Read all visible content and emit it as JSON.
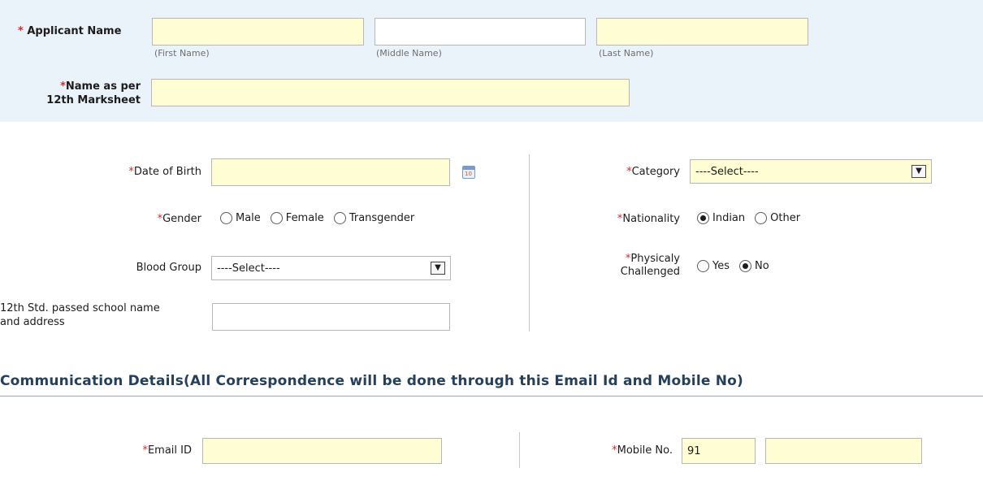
{
  "applicant": {
    "label": "Applicant Name",
    "first_hint": "(First Name)",
    "middle_hint": "(Middle Name)",
    "last_hint": "(Last Name)",
    "marksheet_label_line1": "Name as per",
    "marksheet_label_line2": "12th Marksheet"
  },
  "personal": {
    "dob_label": "Date of Birth",
    "gender_label": "Gender",
    "gender_options": [
      "Male",
      "Female",
      "Transgender"
    ],
    "blood_group_label": "Blood Group",
    "blood_group_value": "----Select----",
    "school_label_line1": "12th Std. passed school name",
    "school_label_line2": "and address",
    "category_label": "Category",
    "category_value": "----Select----",
    "nationality_label": "Nationality",
    "nationality_options": [
      "Indian",
      "Other"
    ],
    "nationality_selected": "Indian",
    "physically_label_line1": "Physicaly",
    "physically_label_line2": "Challenged",
    "physically_options": [
      "Yes",
      "No"
    ],
    "physically_selected": "No"
  },
  "communication": {
    "title": "Communication Details(All Correspondence will be done through this Email Id and Mobile No)",
    "email_label": "Email ID",
    "mobile_label": "Mobile No.",
    "mobile_prefix": "91"
  },
  "required_marker": "*",
  "colors": {
    "panel_bg": "#eaf2fa",
    "input_fill": "#fefdd3",
    "required": "#d62b2b",
    "section_title": "#24405c"
  }
}
